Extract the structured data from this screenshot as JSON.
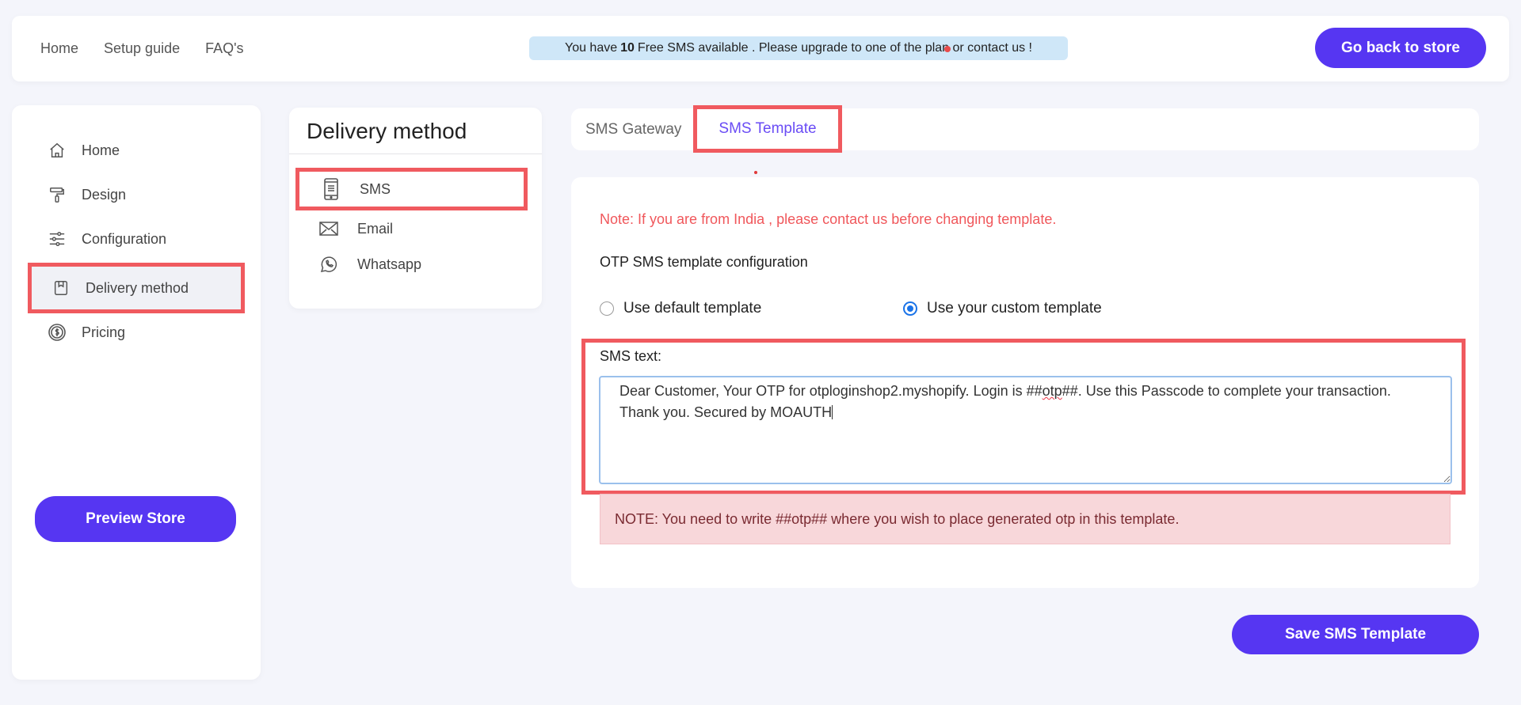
{
  "topbar": {
    "nav": [
      "Home",
      "Setup guide",
      "FAQ's"
    ],
    "banner_prefix": "You have",
    "banner_count": "10",
    "banner_suffix": "Free SMS available . Please upgrade to one of the plan or contact us !",
    "go_back_label": "Go back to store"
  },
  "sidebar": {
    "items": [
      {
        "label": "Home",
        "icon": "home-icon"
      },
      {
        "label": "Design",
        "icon": "paint-roller-icon"
      },
      {
        "label": "Configuration",
        "icon": "sliders-icon"
      },
      {
        "label": "Delivery method",
        "icon": "delivery-icon"
      },
      {
        "label": "Pricing",
        "icon": "dollar-coin-icon"
      }
    ],
    "preview_label": "Preview Store"
  },
  "delivery": {
    "title": "Delivery method",
    "items": [
      {
        "label": "SMS",
        "icon": "phone-icon"
      },
      {
        "label": "Email",
        "icon": "envelope-icon"
      },
      {
        "label": "Whatsapp",
        "icon": "whatsapp-icon"
      }
    ]
  },
  "tabs": {
    "gateway": "SMS Gateway",
    "template": "SMS Template"
  },
  "main": {
    "note": "Note: If you are from India , please contact us before changing template.",
    "section_title": "OTP SMS template configuration",
    "radio_default": "Use default template",
    "radio_custom": "Use your custom template",
    "sms_label": "SMS text:",
    "sms_text_before": "Dear Customer, Your OTP for otploginshop2.myshopify. Login is ##",
    "sms_text_otp": "otp",
    "sms_text_after": "##. Use this Passcode to complete your transaction. Thank you. Secured by MOAUTH",
    "hint": "NOTE: You need to write ##otp## where you wish to place generated otp in this template.",
    "save_label": "Save SMS Template"
  },
  "colors": {
    "accent": "#5636f2",
    "highlight_border": "#f05a5f",
    "active_tab_text": "#6a4cf5"
  }
}
